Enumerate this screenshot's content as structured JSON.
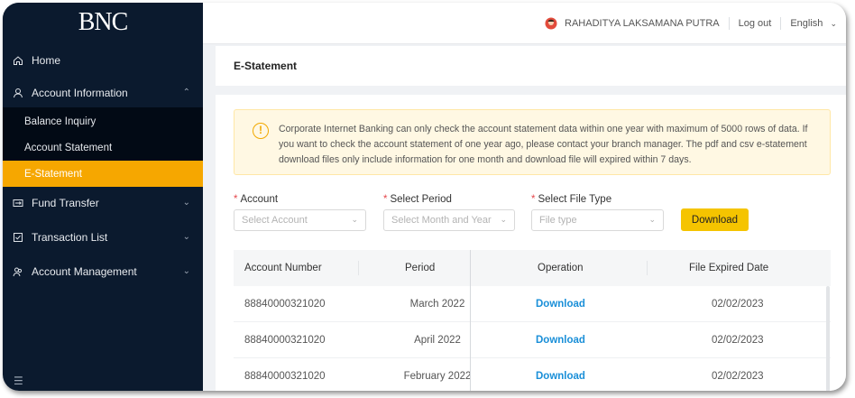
{
  "brand": {
    "logo_text": "BNC"
  },
  "sidebar": {
    "items": [
      {
        "label": "Home",
        "icon": "home-icon"
      },
      {
        "label": "Account Information",
        "icon": "user-icon",
        "expanded": true
      },
      {
        "label": "Fund Transfer",
        "icon": "transfer-icon"
      },
      {
        "label": "Transaction List",
        "icon": "checklist-icon"
      },
      {
        "label": "Account Management",
        "icon": "users-icon"
      }
    ],
    "subitems": [
      {
        "label": "Balance Inquiry"
      },
      {
        "label": "Account Statement"
      },
      {
        "label": "E-Statement",
        "active": true
      }
    ]
  },
  "header": {
    "user_name": "RAHADITYA LAKSAMANA PUTRA",
    "logout_label": "Log out",
    "language": "English"
  },
  "page": {
    "title": "E-Statement"
  },
  "notice": {
    "text": "Corporate Internet Banking can only check the account statement data within one year with maximum of 5000 rows of data. If you want to check the account statement of one year ago, please contact your branch manager. The pdf and csv e-statement download files only include information for one month and download file will expired within 7 days."
  },
  "form": {
    "account": {
      "label": "Account",
      "placeholder": "Select Account"
    },
    "period": {
      "label": "Select Period",
      "placeholder": "Select Month and Year"
    },
    "file_type": {
      "label": "Select File Type",
      "placeholder": "File type"
    },
    "download_label": "Download"
  },
  "table": {
    "columns": [
      "Account Number",
      "Period",
      "Operation",
      "File Expired Date"
    ],
    "rows": [
      {
        "account": "88840000321020",
        "period": "March 2022",
        "operation": "Download",
        "expired": "02/02/2023"
      },
      {
        "account": "88840000321020",
        "period": "April 2022",
        "operation": "Download",
        "expired": "02/02/2023"
      },
      {
        "account": "88840000321020",
        "period": "February 2022",
        "operation": "Download",
        "expired": "02/02/2023"
      }
    ]
  },
  "colors": {
    "accent": "#f6a700",
    "sidebar_bg": "#0b1a2e",
    "link": "#1a8fd8",
    "button": "#f5c400"
  }
}
